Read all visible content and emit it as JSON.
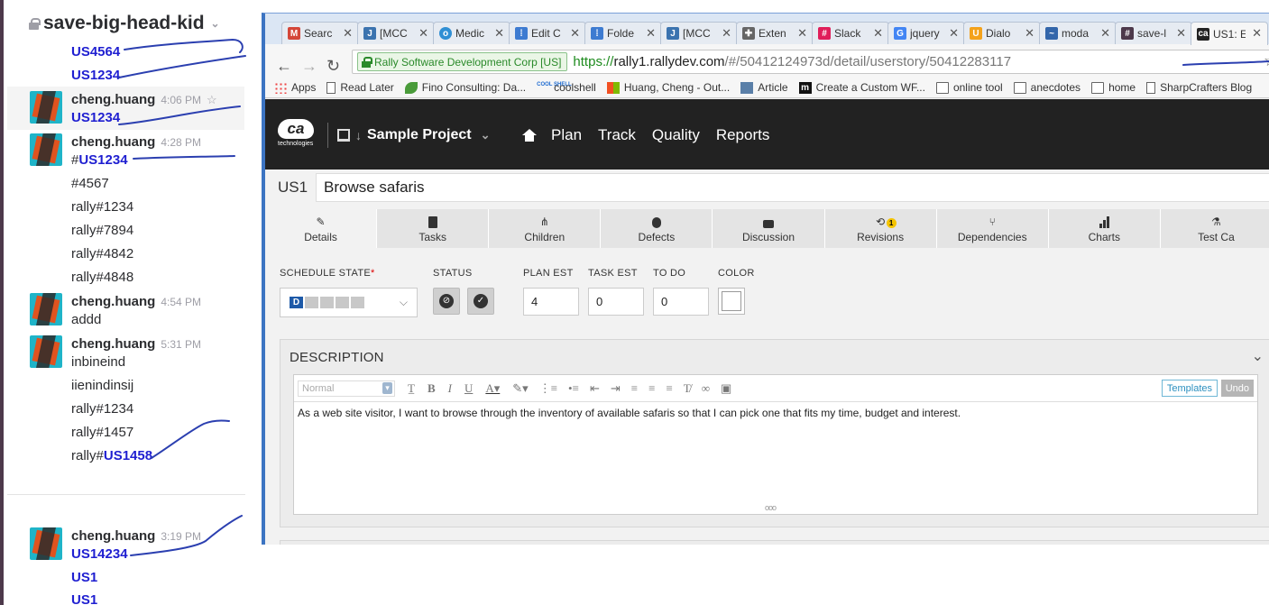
{
  "slack": {
    "channel": "save-big-head-kid",
    "messages": [
      {
        "link": "US4564"
      },
      {
        "link": "US1234"
      }
    ],
    "groups": [
      {
        "author": "cheng.huang",
        "time": "4:06 PM",
        "lines": [
          "US1234"
        ]
      },
      {
        "author": "cheng.huang",
        "time": "4:28 PM",
        "first_prefix": "#",
        "first_link": "US1234",
        "lines": [
          "#4567",
          "rally#1234",
          "rally#7894",
          "rally#4842",
          "rally#4848"
        ]
      },
      {
        "author": "cheng.huang",
        "time": "4:54 PM",
        "lines": [
          "addd"
        ]
      },
      {
        "author": "cheng.huang",
        "time": "5:31 PM",
        "lines": [
          "inbineind",
          "iienindinsij",
          "rally#1234",
          "rally#1457"
        ],
        "last_prefix": "rally#",
        "last_link": "US1458"
      },
      {
        "author": "cheng.huang",
        "time": "3:19 PM",
        "lines": [
          "US14234",
          "US1",
          "US1"
        ]
      }
    ]
  },
  "browser": {
    "tabs": [
      {
        "label": "Searc",
        "icon": "gmail-icon",
        "color": "#d44638"
      },
      {
        "label": "[MCC",
        "icon": "jira-icon",
        "color": "#3b73af"
      },
      {
        "label": "Medic",
        "icon": "circle-icon",
        "color": "#2f8fd4"
      },
      {
        "label": "Edit C",
        "icon": "grid-icon",
        "color": "#3d7bd1"
      },
      {
        "label": "Folde",
        "icon": "grid-icon",
        "color": "#3d7bd1"
      },
      {
        "label": "[MCC",
        "icon": "jira-icon",
        "color": "#3b73af"
      },
      {
        "label": "Exten",
        "icon": "puzzle-icon",
        "color": "#666666"
      },
      {
        "label": "Slack",
        "icon": "slack-icon",
        "color": "#e01e5a"
      },
      {
        "label": "jquery",
        "icon": "google-icon",
        "color": "#4285f4"
      },
      {
        "label": "Dialo",
        "icon": "shield-icon",
        "color": "#f4a21b"
      },
      {
        "label": "moda",
        "icon": "wave-icon",
        "color": "#3366aa"
      },
      {
        "label": "save-l",
        "icon": "hash-icon",
        "color": "#4d394b"
      },
      {
        "label": "US1: E",
        "icon": "ca-icon",
        "color": "#222222"
      }
    ],
    "ev_badge": "Rally Software Development Corp [US]",
    "url_scheme": "https://",
    "url_host": "rally1.rallydev.com",
    "url_rest": "/#/50412124973d/detail/userstory/50412283117",
    "bookmarks": [
      "Apps",
      "Read Later",
      "Fino Consulting: Da...",
      "coolshell",
      "Huang, Cheng - Out...",
      "Article",
      "Create a Custom WF...",
      "online tool",
      "anecdotes",
      "home",
      "SharpCrafters Blog"
    ]
  },
  "rally": {
    "logo": "ca",
    "logo_sub": "technologies",
    "project": "Sample Project",
    "menu": [
      "Plan",
      "Track",
      "Quality",
      "Reports"
    ],
    "story_id": "US1",
    "story_title": "Browse safaris",
    "tabs": [
      "Details",
      "Tasks",
      "Children",
      "Defects",
      "Discussion",
      "Revisions",
      "Dependencies",
      "Charts",
      "Test Ca"
    ],
    "revisions_badge": "1",
    "labels": {
      "schedule_state": "SCHEDULE STATE",
      "status": "STATUS",
      "plan_est": "PLAN EST",
      "task_est": "TASK EST",
      "to_do": "TO DO",
      "color": "COLOR"
    },
    "schedule_state_value": "D",
    "plan_est": "4",
    "task_est": "0",
    "to_do": "0",
    "description_title": "DESCRIPTION",
    "editor_format": "Normal",
    "templates_label": "Templates",
    "undo_label": "Undo",
    "description_text": "As a web site visitor, I want to browse through the inventory of available safaris so that I can pick one that fits my time, budget and interest."
  },
  "colors": {
    "annotation": "#2b3fb0",
    "link": "#1f1fd1",
    "rally_bar": "#222222"
  }
}
